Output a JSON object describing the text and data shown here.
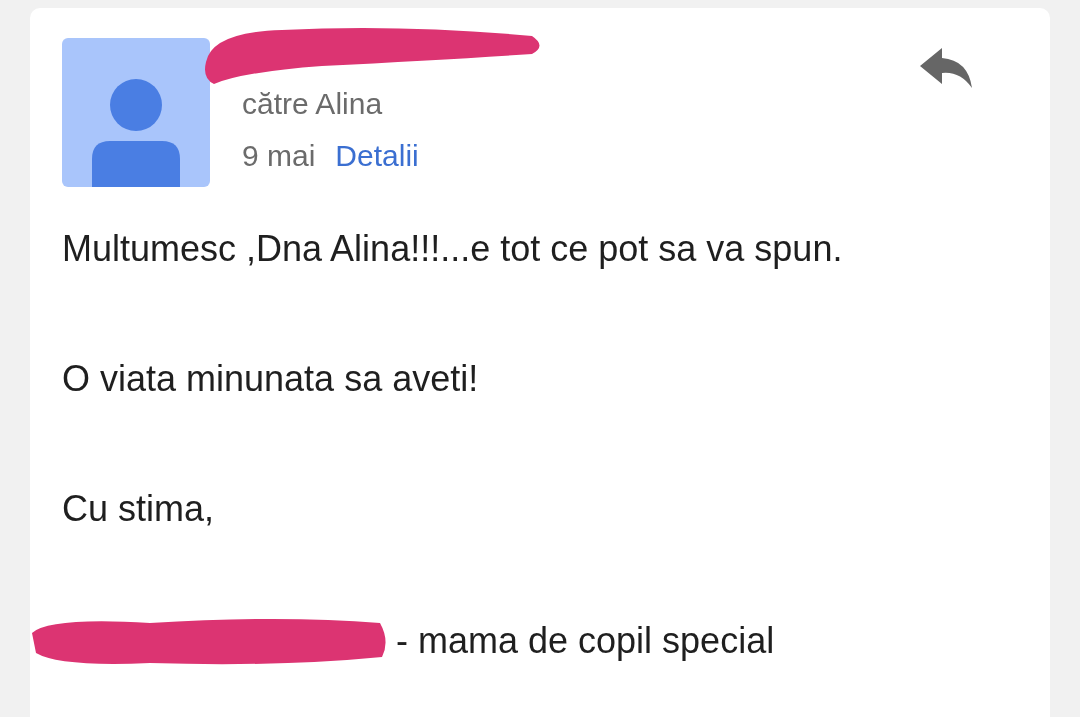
{
  "message": {
    "recipient_line": "către Alina",
    "date": "9 mai",
    "details_link": "Detalii",
    "body": [
      "Multumesc ,Dna Alina!!!...e tot ce pot sa va spun.",
      "O viata minunata sa aveti!",
      "Cu stima,"
    ],
    "signature": "- mama de copil special"
  }
}
